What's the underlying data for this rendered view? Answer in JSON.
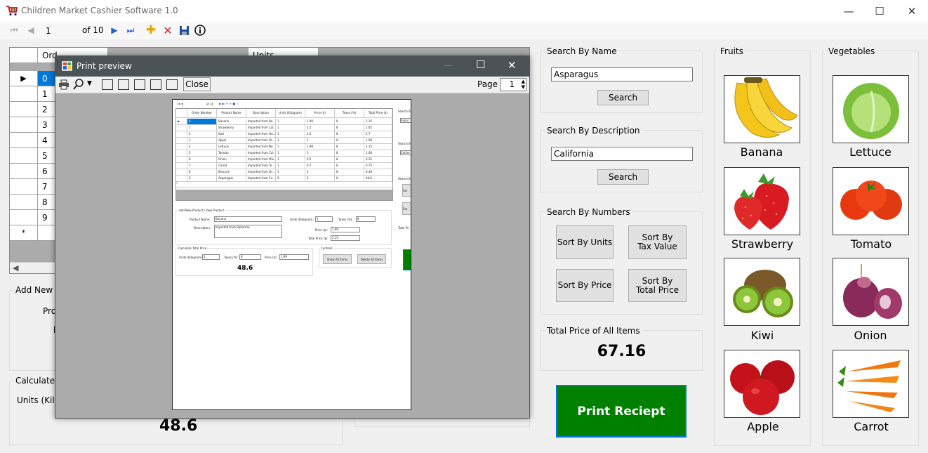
{
  "window": {
    "title": "Children Market Cashier Software 1.0",
    "minimize": "—",
    "maximize": "☐",
    "close": "✕"
  },
  "navigator": {
    "position": "1",
    "of_label": "of 10"
  },
  "grid": {
    "header_fragment": "Ord",
    "units_fragment": "Units",
    "rows": [
      "0",
      "1",
      "2",
      "3",
      "4",
      "5",
      "6",
      "7",
      "8",
      "9"
    ],
    "new_row_marker": "*"
  },
  "left_panels": {
    "add_new_fragment": "Add New Pr",
    "product_fragment": "Proc",
    "calculate_fragment": "Calculate To",
    "units_fragment": "Units (Kilogr",
    "result": "48.6"
  },
  "search_name": {
    "label": "Search By Name",
    "value": "Asparagus",
    "button": "Search"
  },
  "search_desc": {
    "label": "Search By Description",
    "value": "California",
    "button": "Search"
  },
  "search_numbers": {
    "label": "Search By Numbers",
    "sort_units": "Sort By Units",
    "sort_tax": "Sort By Tax Value",
    "sort_price": "Sort By Price",
    "sort_total": "Sort By Total Price"
  },
  "total": {
    "label": "Total Price of All Items",
    "value": "67.16"
  },
  "print_button": "Print Reciept",
  "fruits": {
    "label": "Fruits",
    "items": [
      "Banana",
      "Strawberry",
      "Kiwi",
      "Apple"
    ]
  },
  "vegetables": {
    "label": "Vegetables",
    "items": [
      "Lettuce",
      "Tomato",
      "Onion",
      "Carrot"
    ]
  },
  "print_preview": {
    "title": "Print preview",
    "close": "Close",
    "page_label": "Page",
    "page_value": "1",
    "page": {
      "nav_of": "of 10",
      "headers": [
        "Order Number",
        "Product Name",
        "Description",
        "Units (Kilogram)",
        "Price ($)",
        "Taxes (%)",
        "Total Price ($)"
      ],
      "rows": [
        [
          "0",
          "Banana",
          "Imported from Ba...",
          "1",
          "1.99",
          "8",
          "2.15"
        ],
        [
          "1",
          "Strawberry",
          "Imported from Cal...",
          "1",
          "1.5",
          "8",
          "1.62"
        ],
        [
          "2",
          "Kiwi",
          "Imported from Ha...",
          "1",
          "2.5",
          "8",
          "2.7"
        ],
        [
          "3",
          "Apple",
          "Imported from W...",
          "1",
          "1",
          "8",
          "1.08"
        ],
        [
          "4",
          "Lettuce",
          "Imported from Ne...",
          "1",
          "1.99",
          "8",
          "2.15"
        ],
        [
          "5",
          "Tomato",
          "Imported from Cal...",
          "1",
          "1",
          "8",
          "1.08"
        ],
        [
          "6",
          "Onion",
          "Imported from Mis...",
          "1",
          "0.5",
          "8",
          "0.55"
        ],
        [
          "7",
          "Carrot",
          "Imported from Te...",
          "1",
          "0.7",
          "8",
          "0.75"
        ],
        [
          "8",
          "Broccoli",
          "Imported from Or...",
          "3",
          "2",
          "8",
          "6.48"
        ],
        [
          "9",
          "Asparagus",
          "Imported from Ca...",
          "9",
          "5",
          "8",
          "48.6"
        ]
      ],
      "add_group": "Add New Product / View Product",
      "product_name_label": "Product Name:",
      "product_name_value": "Banana",
      "units_label": "Units (Kilogram):",
      "units_value": "1",
      "taxes_label": "Taxes (%):",
      "taxes_value": "8",
      "description_label": "Description:",
      "description_value": "Imported from Bahamas",
      "price_label": "Price ($):",
      "price_value": "1.99",
      "total_label": "Total Price ($):",
      "total_value": "2.15",
      "calc_group": "Calculate Total Price",
      "calc_units": "Units (Kilogram):",
      "calc_units_value": "1",
      "calc_taxes": "Taxes (%):",
      "calc_taxes_value": "8",
      "calc_price": "Price ($):",
      "calc_price_value": "1.99",
      "calc_result": "48.6",
      "controls_group": "Controls",
      "show_all": "Show All Items",
      "delete_all": "Delete All Items",
      "right_search_1": "Search B",
      "right_search_1_value": "Aspar",
      "right_search_2": "Search B",
      "right_search_2_value": "Califor",
      "right_search_3": "Search B",
      "right_sort_1": "Sor",
      "right_sort_2": "Sor",
      "right_total": "Total Pri"
    }
  },
  "colors": {
    "accent_blue": "#0078d7",
    "print_green": "#008000",
    "dialog_title": "#4b5357"
  }
}
